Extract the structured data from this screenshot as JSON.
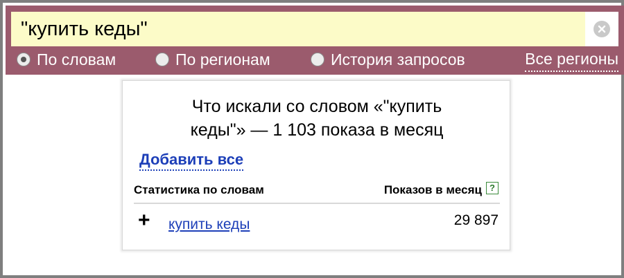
{
  "search": {
    "value": "\"купить кеды\"",
    "clear_icon": "close-circle-icon"
  },
  "modes": [
    {
      "label": "По словам",
      "checked": true
    },
    {
      "label": "По регионам",
      "checked": false
    },
    {
      "label": "История запросов",
      "checked": false
    }
  ],
  "regions_link": "Все регионы",
  "panel": {
    "title_line1": "Что искали со словом «\"купить",
    "title_line2": "кеды\"» — 1 103 показа в месяц",
    "add_all": "Добавить все",
    "col_words": "Статистика по словам",
    "col_shows": "Показов в месяц",
    "help_glyph": "?",
    "rows": [
      {
        "action": "+",
        "phrase": "купить кеды",
        "count": "29 897"
      }
    ]
  },
  "colors": {
    "topbar": "#9b5b6d",
    "search_bg": "#fcfbc8",
    "link": "#1d3fb8",
    "help": "#2c7a2c"
  }
}
